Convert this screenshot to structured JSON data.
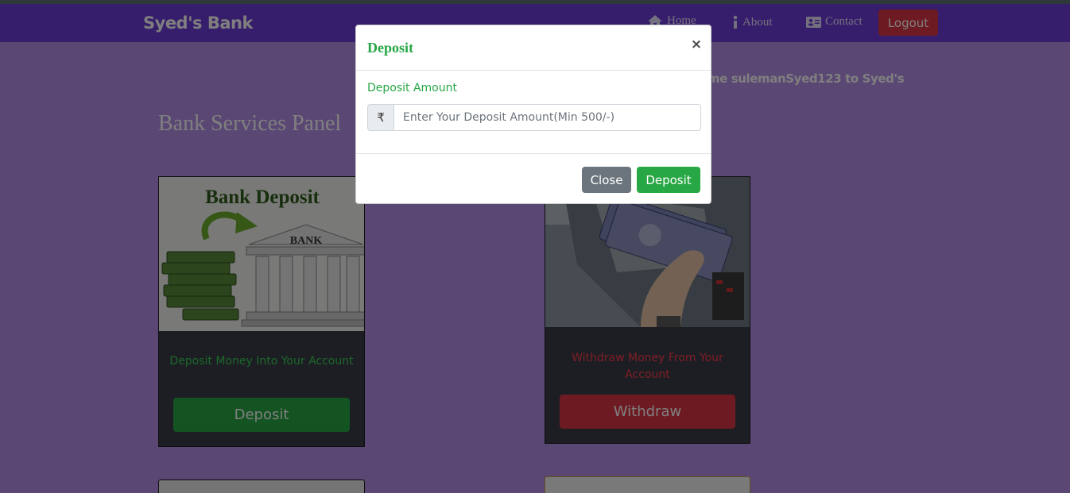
{
  "navbar": {
    "brand": "Syed's Bank",
    "items": [
      {
        "label": "Home",
        "icon": "home-icon"
      },
      {
        "label": "About",
        "icon": "info-icon"
      },
      {
        "label": "Contact",
        "icon": "contact-card-icon"
      }
    ],
    "logout_label": "Logout"
  },
  "page": {
    "welcome_text": "ome sulemanSyed123 to Syed's",
    "panel_title": "Bank Services Panel",
    "cards": [
      {
        "image_heading": "Bank Deposit",
        "image_sign": "BANK",
        "text": "Deposit Money Into Your Account",
        "button_label": "Deposit"
      },
      {
        "text": "Withdraw Money From Your Account",
        "button_label": "Withdraw"
      }
    ]
  },
  "modal": {
    "title": "Deposit",
    "close_symbol": "×",
    "field_label": "Deposit Amount",
    "currency_symbol": "₹",
    "amount_value": "",
    "amount_placeholder": "Enter Your Deposit Amount(Min 500/-)",
    "close_button": "Close",
    "submit_button": "Deposit"
  },
  "colors": {
    "navbar": "#6f3dd8",
    "page_background": "#b58fe8",
    "success": "#28a745",
    "danger": "#dc3545",
    "secondary": "#6c757d"
  }
}
